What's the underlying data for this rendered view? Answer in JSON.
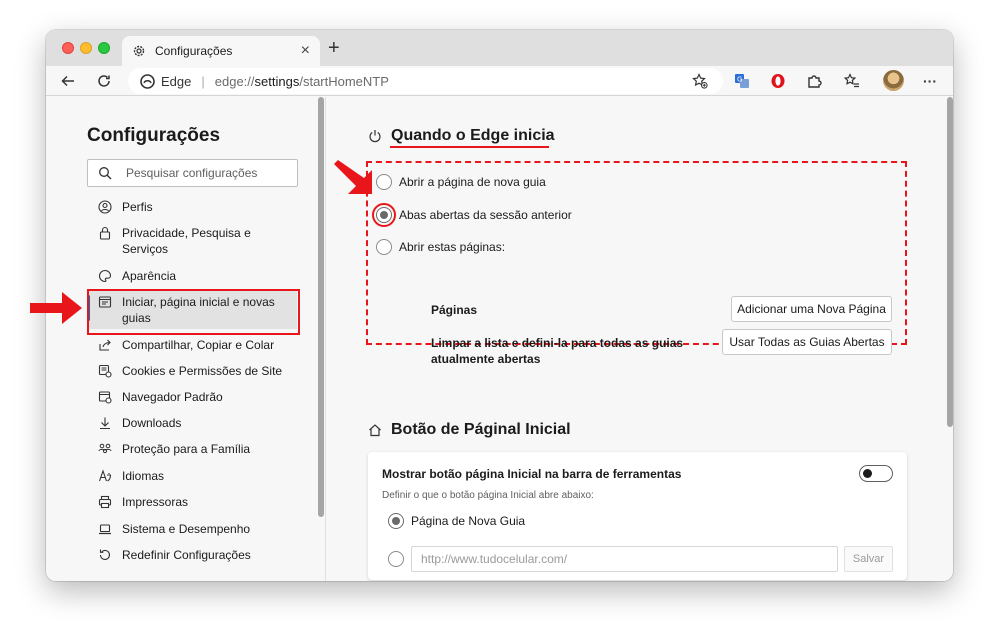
{
  "browser": {
    "tab_title": "Configurações",
    "new_tab_label": "+",
    "close_label": "×",
    "address": {
      "site_label": "Edge",
      "scheme": "edge://",
      "host": "settings",
      "path": "/startHomeNTP"
    }
  },
  "sidebar": {
    "title": "Configurações",
    "search_placeholder": "Pesquisar configurações",
    "items": [
      {
        "label": "Perfis",
        "icon": "profile-icon"
      },
      {
        "label": "Privacidade, Pesquisa e Serviços",
        "icon": "lock-icon"
      },
      {
        "label": "Aparência",
        "icon": "palette-icon"
      },
      {
        "label": "Iniciar, página inicial e novas guias",
        "icon": "new-tab-icon",
        "active": true
      },
      {
        "label": "Compartilhar, Copiar e Colar",
        "icon": "share-icon"
      },
      {
        "label": "Cookies e Permissões de Site",
        "icon": "cookies-icon"
      },
      {
        "label": "Navegador Padrão",
        "icon": "default-browser-icon"
      },
      {
        "label": "Downloads",
        "icon": "download-icon"
      },
      {
        "label": "Proteção para a Família",
        "icon": "family-icon"
      },
      {
        "label": "Idiomas",
        "icon": "language-icon"
      },
      {
        "label": "Impressoras",
        "icon": "printer-icon"
      },
      {
        "label": "Sistema e Desempenho",
        "icon": "laptop-icon"
      },
      {
        "label": "Redefinir Configurações",
        "icon": "reset-icon"
      }
    ]
  },
  "startup": {
    "title": "Quando o Edge inicia",
    "options": [
      {
        "label": "Abrir a página de nova guia",
        "checked": false
      },
      {
        "label": "Abas abertas da sessão anterior",
        "checked": true
      },
      {
        "label": "Abrir estas páginas:",
        "checked": false
      }
    ],
    "pages_label": "Páginas",
    "add_page_button": "Adicionar uma Nova Página",
    "clear_label": "Limpar a lista e defini-la para todas as guias atualmente abertas",
    "use_all_button": "Usar Todas as Guias Abertas"
  },
  "home_button": {
    "title": "Botão de Páginal Inicial",
    "toggle_label": "Mostrar botão página Inicial na barra de ferramentas",
    "toggle_on": false,
    "description": "Definir o que o botão página Inicial abre abaixo:",
    "option_new_tab": "Página de Nova Guia",
    "url_placeholder": "http://www.tudocelular.com/",
    "save_button": "Salvar"
  },
  "colors": {
    "annotation_red": "#e8161b",
    "accent_blue": "#0f6cbd"
  }
}
